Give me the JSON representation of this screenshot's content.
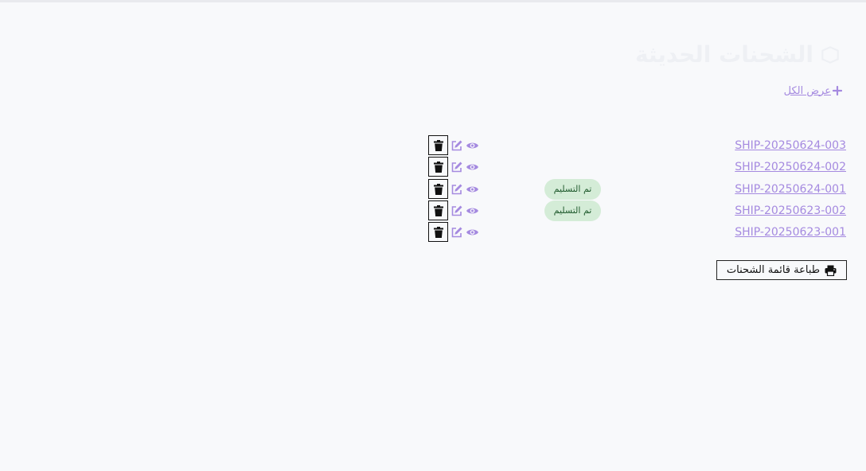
{
  "page": {
    "title": "الشحنات الحديثة"
  },
  "view_all": {
    "label": "عرض الكل",
    "icon": "plus-icon"
  },
  "shipments": [
    {
      "id": "SHIP-20250624-003",
      "status": ""
    },
    {
      "id": "SHIP-20250624-002",
      "status": ""
    },
    {
      "id": "SHIP-20250624-001",
      "status": "تم التسليم"
    },
    {
      "id": "SHIP-20250623-002",
      "status": "تم التسليم"
    },
    {
      "id": "SHIP-20250623-001",
      "status": ""
    }
  ],
  "row_actions": {
    "view_icon": "eye-icon",
    "edit_icon": "edit-icon",
    "delete_icon": "trash-icon"
  },
  "print_button": {
    "label": "طباعة قائمة الشحنات",
    "icon": "print-icon"
  },
  "colors": {
    "accent": "#a58ae0",
    "badge_bg": "#d4ecd7",
    "badge_text": "#1f5a2d",
    "background": "#f8f9fb"
  }
}
